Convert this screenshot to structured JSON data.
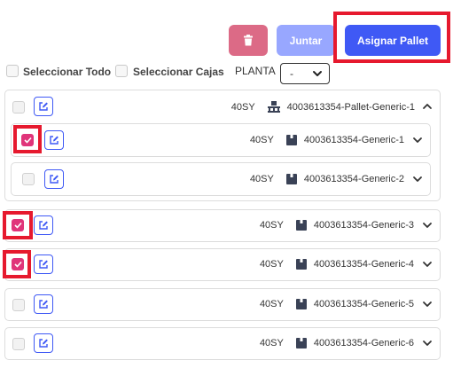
{
  "toolbar": {
    "delete_icon": "trash-icon",
    "join_label": "Juntar",
    "assign_label": "Asignar Pallet"
  },
  "selection": {
    "select_all_label": "Seleccionar Todo",
    "select_boxes_label": "Seleccionar Cajas",
    "planta_label": "PLANTA",
    "planta_value": "-"
  },
  "rows": [
    {
      "code": "40SY",
      "name": "4003613354-Pallet-Generic-1",
      "icon": "pallet-icon",
      "checked": false,
      "chevron": "chevron-up-icon"
    },
    {
      "code": "40SY",
      "name": "4003613354-Generic-1",
      "icon": "box-icon",
      "checked": true,
      "chevron": "chevron-down-icon"
    },
    {
      "code": "40SY",
      "name": "4003613354-Generic-2",
      "icon": "box-icon",
      "checked": false,
      "chevron": "chevron-down-icon"
    },
    {
      "code": "40SY",
      "name": "4003613354-Generic-3",
      "icon": "box-icon",
      "checked": true,
      "chevron": "chevron-down-icon"
    },
    {
      "code": "40SY",
      "name": "4003613354-Generic-4",
      "icon": "box-icon",
      "checked": true,
      "chevron": "chevron-down-icon"
    },
    {
      "code": "40SY",
      "name": "4003613354-Generic-5",
      "icon": "box-icon",
      "checked": false,
      "chevron": "chevron-down-icon"
    },
    {
      "code": "40SY",
      "name": "4003613354-Generic-6",
      "icon": "box-icon",
      "checked": false,
      "chevron": "chevron-down-icon"
    }
  ],
  "colors": {
    "accent": "#3f59f5",
    "delete": "#dc6a86",
    "join": "#98a7ff",
    "checked": "#e0347a",
    "highlight": "#e6192e"
  }
}
